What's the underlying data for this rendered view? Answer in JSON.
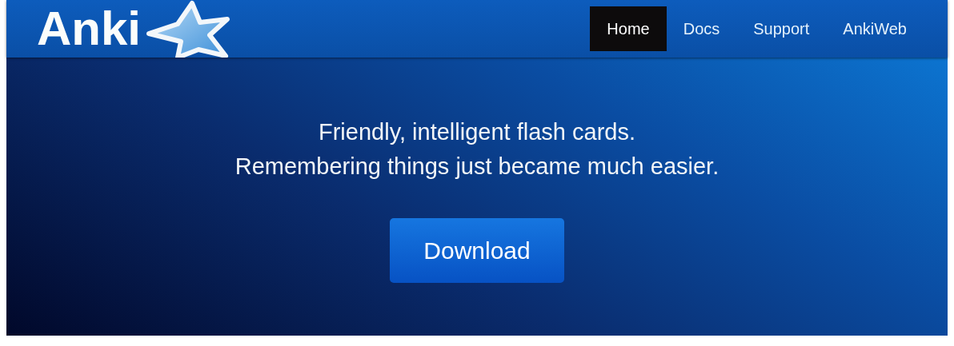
{
  "logo": {
    "text": "Anki"
  },
  "nav": [
    {
      "label": "Home",
      "selected": true
    },
    {
      "label": "Docs",
      "selected": false
    },
    {
      "label": "Support",
      "selected": false
    },
    {
      "label": "AnkiWeb",
      "selected": false
    }
  ],
  "hero": {
    "lines": [
      "Friendly, intelligent flash cards.",
      "Remembering things just became much easier."
    ],
    "button": "Download"
  }
}
